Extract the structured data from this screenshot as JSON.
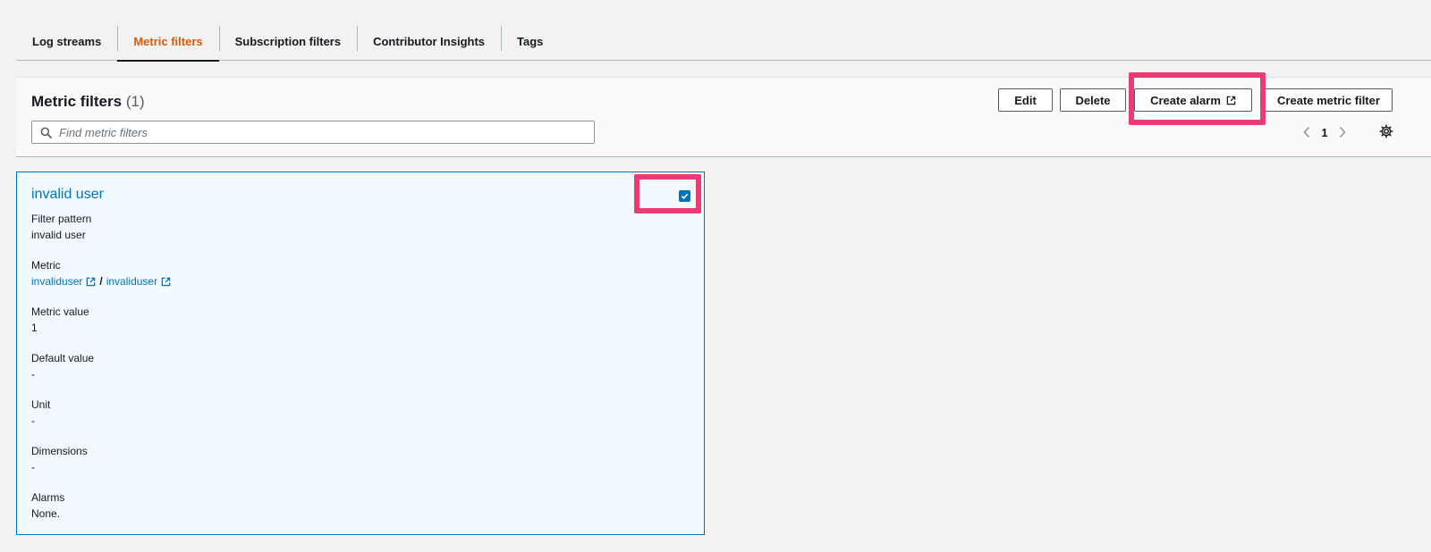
{
  "tabs": [
    {
      "label": "Log streams",
      "active": false
    },
    {
      "label": "Metric filters",
      "active": true
    },
    {
      "label": "Subscription filters",
      "active": false
    },
    {
      "label": "Contributor Insights",
      "active": false
    },
    {
      "label": "Tags",
      "active": false
    }
  ],
  "header": {
    "title": "Metric filters",
    "count": "(1)",
    "buttons": {
      "edit": "Edit",
      "delete": "Delete",
      "create_alarm": "Create alarm",
      "create_metric_filter": "Create metric filter"
    },
    "search": {
      "placeholder": "Find metric filters",
      "value": ""
    },
    "pagination": {
      "current_page": "1"
    }
  },
  "card": {
    "title": "invalid user",
    "selected": true,
    "fields": {
      "filter_pattern": {
        "label": "Filter pattern",
        "value": "invalid user"
      },
      "metric": {
        "label": "Metric",
        "namespace": "invaliduser",
        "separator": "/",
        "name": "invaliduser"
      },
      "metric_value": {
        "label": "Metric value",
        "value": "1"
      },
      "default_value": {
        "label": "Default value",
        "value": "-"
      },
      "unit": {
        "label": "Unit",
        "value": "-"
      },
      "dimensions": {
        "label": "Dimensions",
        "value": "-"
      },
      "alarms": {
        "label": "Alarms",
        "value": "None."
      }
    }
  },
  "colors": {
    "accent": "#0073bb",
    "active_tab": "#d45b07",
    "highlight": "#ec3a73",
    "card_bg": "#f1faff"
  },
  "icons": [
    "external-link-icon",
    "search-icon",
    "chevron-left-icon",
    "chevron-right-icon",
    "gear-icon",
    "checkmark-icon"
  ]
}
